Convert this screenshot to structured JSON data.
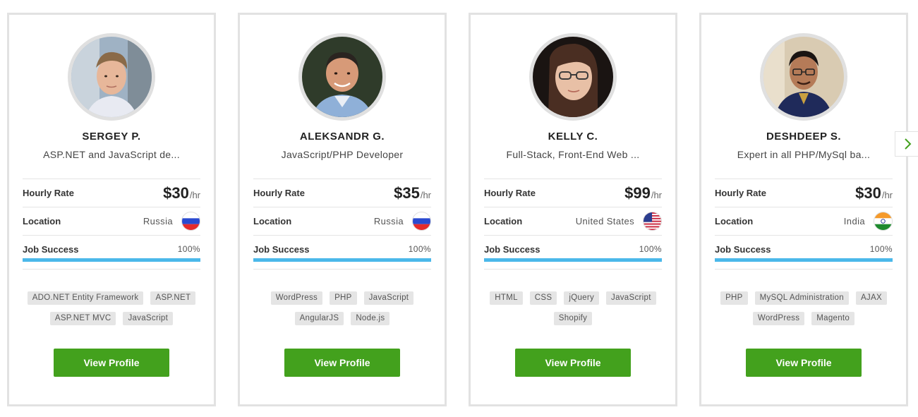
{
  "cards": [
    {
      "name": "SERGEY P.",
      "title": "ASP.NET and JavaScript de...",
      "hourly_label": "Hourly Rate",
      "rate": "$30",
      "rate_unit": "/hr",
      "location_label": "Location",
      "location": "Russia",
      "flag_icon": "russia-flag-icon",
      "job_success_label": "Job Success",
      "job_success": "100%",
      "job_success_fraction": 1.0,
      "skills": [
        "ADO.NET Entity Framework",
        "ASP.NET",
        "ASP.NET MVC",
        "JavaScript"
      ],
      "button": "View Profile"
    },
    {
      "name": "ALEKSANDR G.",
      "title": "JavaScript/PHP Developer",
      "hourly_label": "Hourly Rate",
      "rate": "$35",
      "rate_unit": "/hr",
      "location_label": "Location",
      "location": "Russia",
      "flag_icon": "russia-flag-icon",
      "job_success_label": "Job Success",
      "job_success": "100%",
      "job_success_fraction": 1.0,
      "skills": [
        "WordPress",
        "PHP",
        "JavaScript",
        "AngularJS",
        "Node.js"
      ],
      "button": "View Profile"
    },
    {
      "name": "KELLY C.",
      "title": "Full-Stack, Front-End Web ...",
      "hourly_label": "Hourly Rate",
      "rate": "$99",
      "rate_unit": "/hr",
      "location_label": "Location",
      "location": "United States",
      "flag_icon": "usa-flag-icon",
      "job_success_label": "Job Success",
      "job_success": "100%",
      "job_success_fraction": 1.0,
      "skills": [
        "HTML",
        "CSS",
        "jQuery",
        "JavaScript",
        "Shopify"
      ],
      "button": "View Profile"
    },
    {
      "name": "DESHDEEP S.",
      "title": "Expert in all PHP/MySql ba...",
      "hourly_label": "Hourly Rate",
      "rate": "$30",
      "rate_unit": "/hr",
      "location_label": "Location",
      "location": "India",
      "flag_icon": "india-flag-icon",
      "job_success_label": "Job Success",
      "job_success": "100%",
      "job_success_fraction": 1.0,
      "skills": [
        "PHP",
        "MySQL Administration",
        "AJAX",
        "WordPress",
        "Magento"
      ],
      "button": "View Profile"
    }
  ],
  "next_icon": "chevron-right-icon",
  "colors": {
    "accent_green": "#43a11d",
    "progress_blue": "#4bb8ea",
    "border_gray": "#e2e2e2",
    "chevron_green": "#43a11d"
  }
}
